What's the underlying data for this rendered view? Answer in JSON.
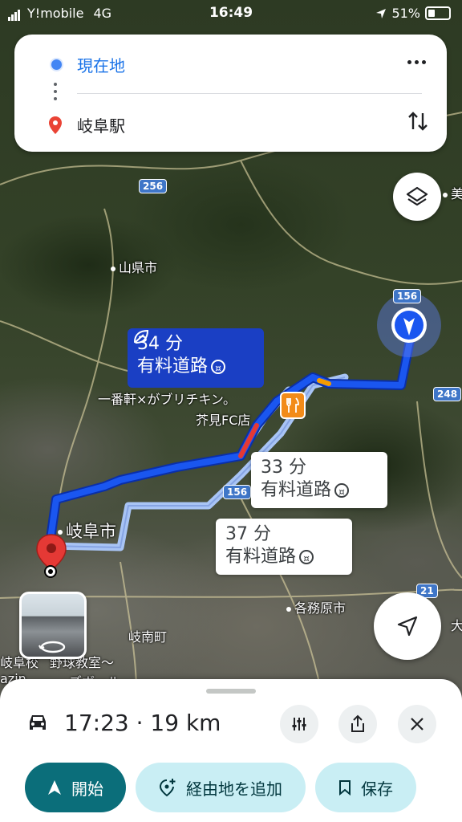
{
  "status_bar": {
    "carrier": "Y!mobile",
    "network": "4G",
    "time": "16:49",
    "battery": "51%"
  },
  "route_card": {
    "origin": "現在地",
    "destination": "岐阜駅"
  },
  "map": {
    "labels": {
      "yamagata": "山県市",
      "gifu_city": "岐阜市",
      "kakamigahara": "各務原市",
      "gifu_minami": "岐南町",
      "restaurant_1": "一番軒×がブリチキン。",
      "restaurant_2": "芥見FC店",
      "edge_top": "美",
      "edge_right": "大",
      "bottom_left_1": "岐阜校",
      "bottom_left_2": "野球教室〜",
      "bottom_left_3": "azin",
      "bottom_left_4": "ズボール"
    },
    "shields": {
      "r256": "256",
      "r156a": "156",
      "r156b": "156",
      "r248": "248",
      "r21": "21"
    },
    "callouts": [
      {
        "time": "34 分",
        "toll": "有料道路"
      },
      {
        "time": "33 分",
        "toll": "有料道路"
      },
      {
        "time": "37 分",
        "toll": "有料道路"
      }
    ],
    "colors": {
      "primary_route": "#1a56f0",
      "alt_route": "#a8c4f5",
      "callout_primary": "#1a3fc4"
    }
  },
  "bottom_sheet": {
    "arrival": "17:23",
    "separator": "·",
    "distance": "19 km",
    "buttons": {
      "start": "開始",
      "add_waypoint": "経由地を追加",
      "save": "保存"
    }
  }
}
